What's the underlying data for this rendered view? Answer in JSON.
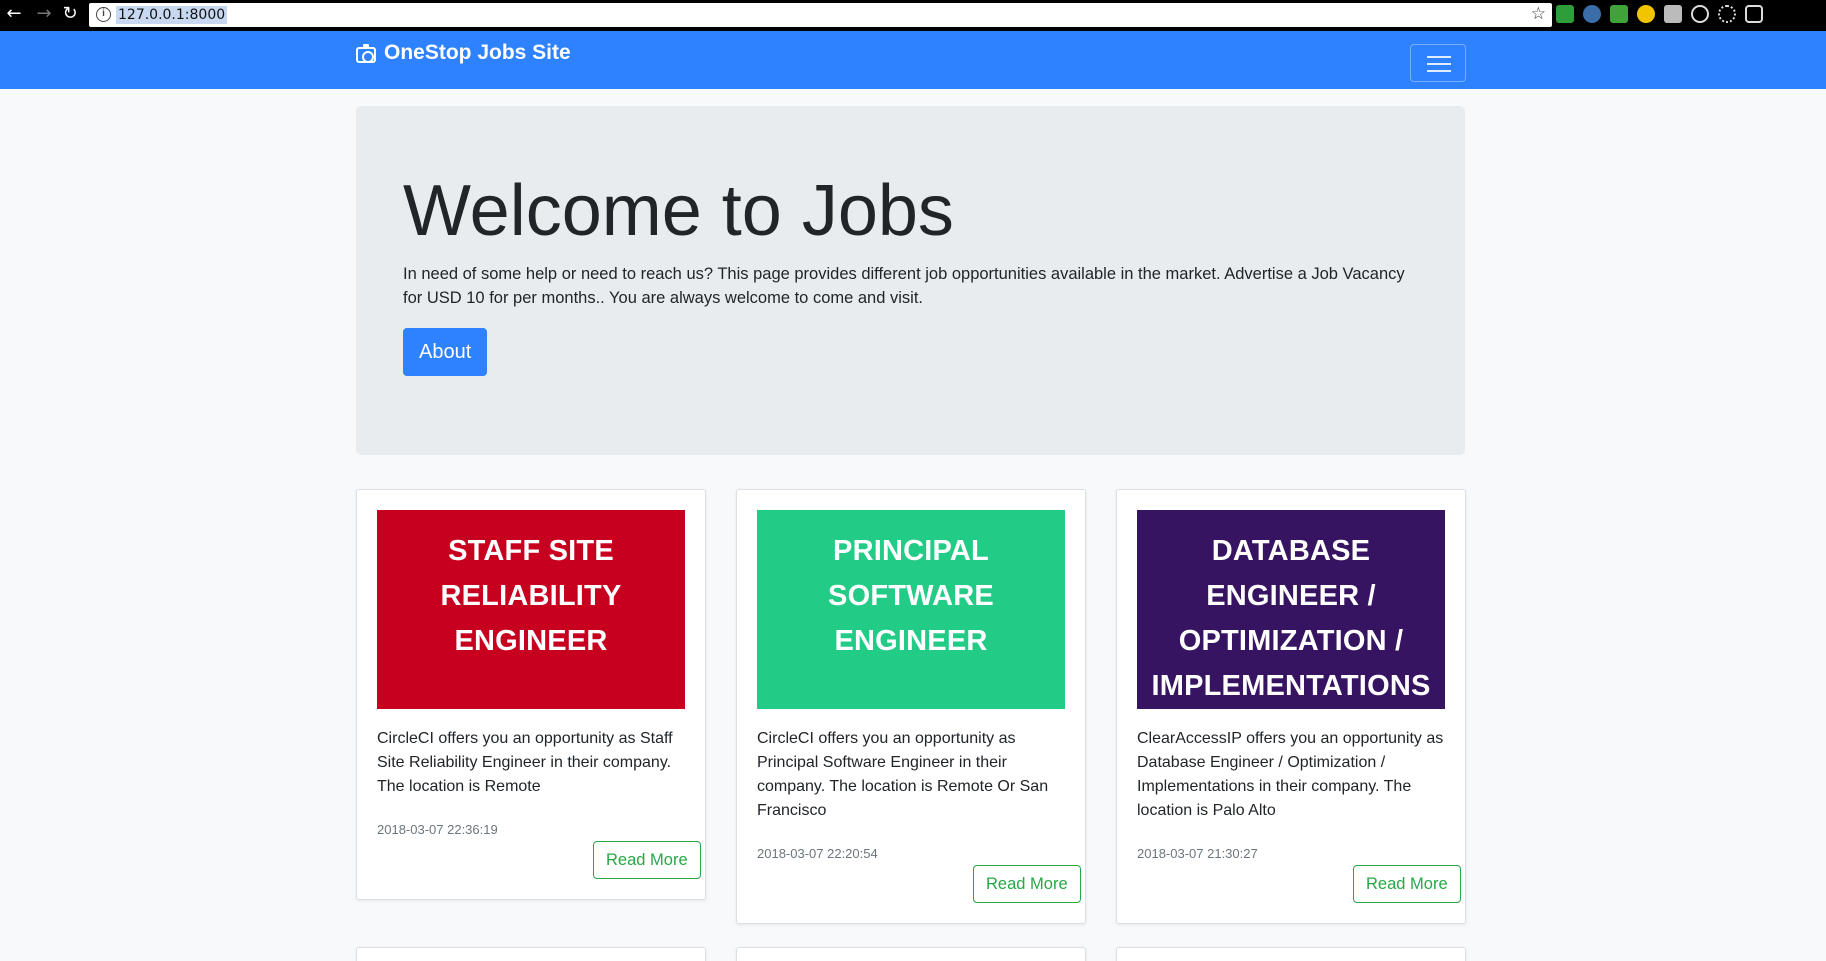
{
  "browser": {
    "url": "127.0.0.1:8000"
  },
  "navbar": {
    "brand": "OneStop Jobs Site",
    "brand_color": "#2e82fd"
  },
  "jumbotron": {
    "title": "Welcome to Jobs",
    "description": "In need of some help or need to reach us? This page provides different job opportunities available in the market. Advertise a Job Vacancy for USD 10 for per months.. You are always welcome to come and visit.",
    "button_label": "About"
  },
  "jobs": [
    {
      "title_lines": [
        "STAFF SITE",
        "RELIABILITY",
        "ENGINEER"
      ],
      "color": "#c8001f",
      "description": "CircleCI offers you an opportunity as Staff Site Reliability Engineer in their company. The location is Remote",
      "date": "2018-03-07 22:36:19",
      "button_label": "Read More"
    },
    {
      "title_lines": [
        "PRINCIPAL",
        "SOFTWARE",
        "ENGINEER"
      ],
      "color": "#22cc86",
      "description": "CircleCI offers you an opportunity as Principal Software Engineer in their company. The location is Remote Or San Francisco",
      "date": "2018-03-07 22:20:54",
      "button_label": "Read More"
    },
    {
      "title_lines": [
        "DATABASE",
        "ENGINEER /",
        "OPTIMIZATION /",
        "IMPLEMENTATIONS"
      ],
      "color": "#361462",
      "description": "ClearAccessIP offers you an opportunity as Database Engineer / Optimization / Implementations in their company. The location is Palo Alto",
      "date": "2018-03-07 21:30:27",
      "button_label": "Read More"
    }
  ]
}
